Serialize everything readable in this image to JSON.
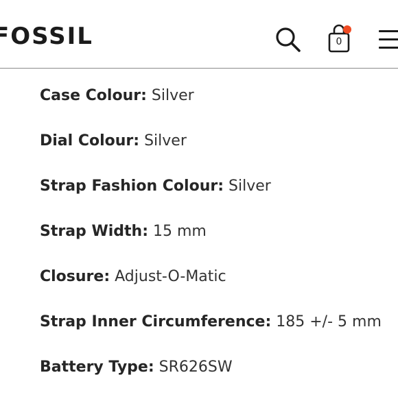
{
  "header": {
    "logo_text": "FOSSIL",
    "cart_count": "0",
    "icons": {
      "search": "search-icon",
      "bag": "shopping-bag-icon",
      "menu": "hamburger-menu-icon"
    },
    "colors": {
      "badge_dot": "#f04b23",
      "divider": "#8a8a8a"
    }
  },
  "specs": [
    {
      "label": "Case Colour:",
      "value": "Silver"
    },
    {
      "label": "Dial Colour:",
      "value": "Silver"
    },
    {
      "label": "Strap Fashion Colour:",
      "value": "Silver"
    },
    {
      "label": "Strap Width:",
      "value": "15 mm"
    },
    {
      "label": "Closure:",
      "value": "Adjust-O-Matic"
    },
    {
      "label": "Strap Inner Circumference:",
      "value": "185 +/- 5 mm"
    },
    {
      "label": "Battery Type:",
      "value": "SR626SW"
    }
  ]
}
